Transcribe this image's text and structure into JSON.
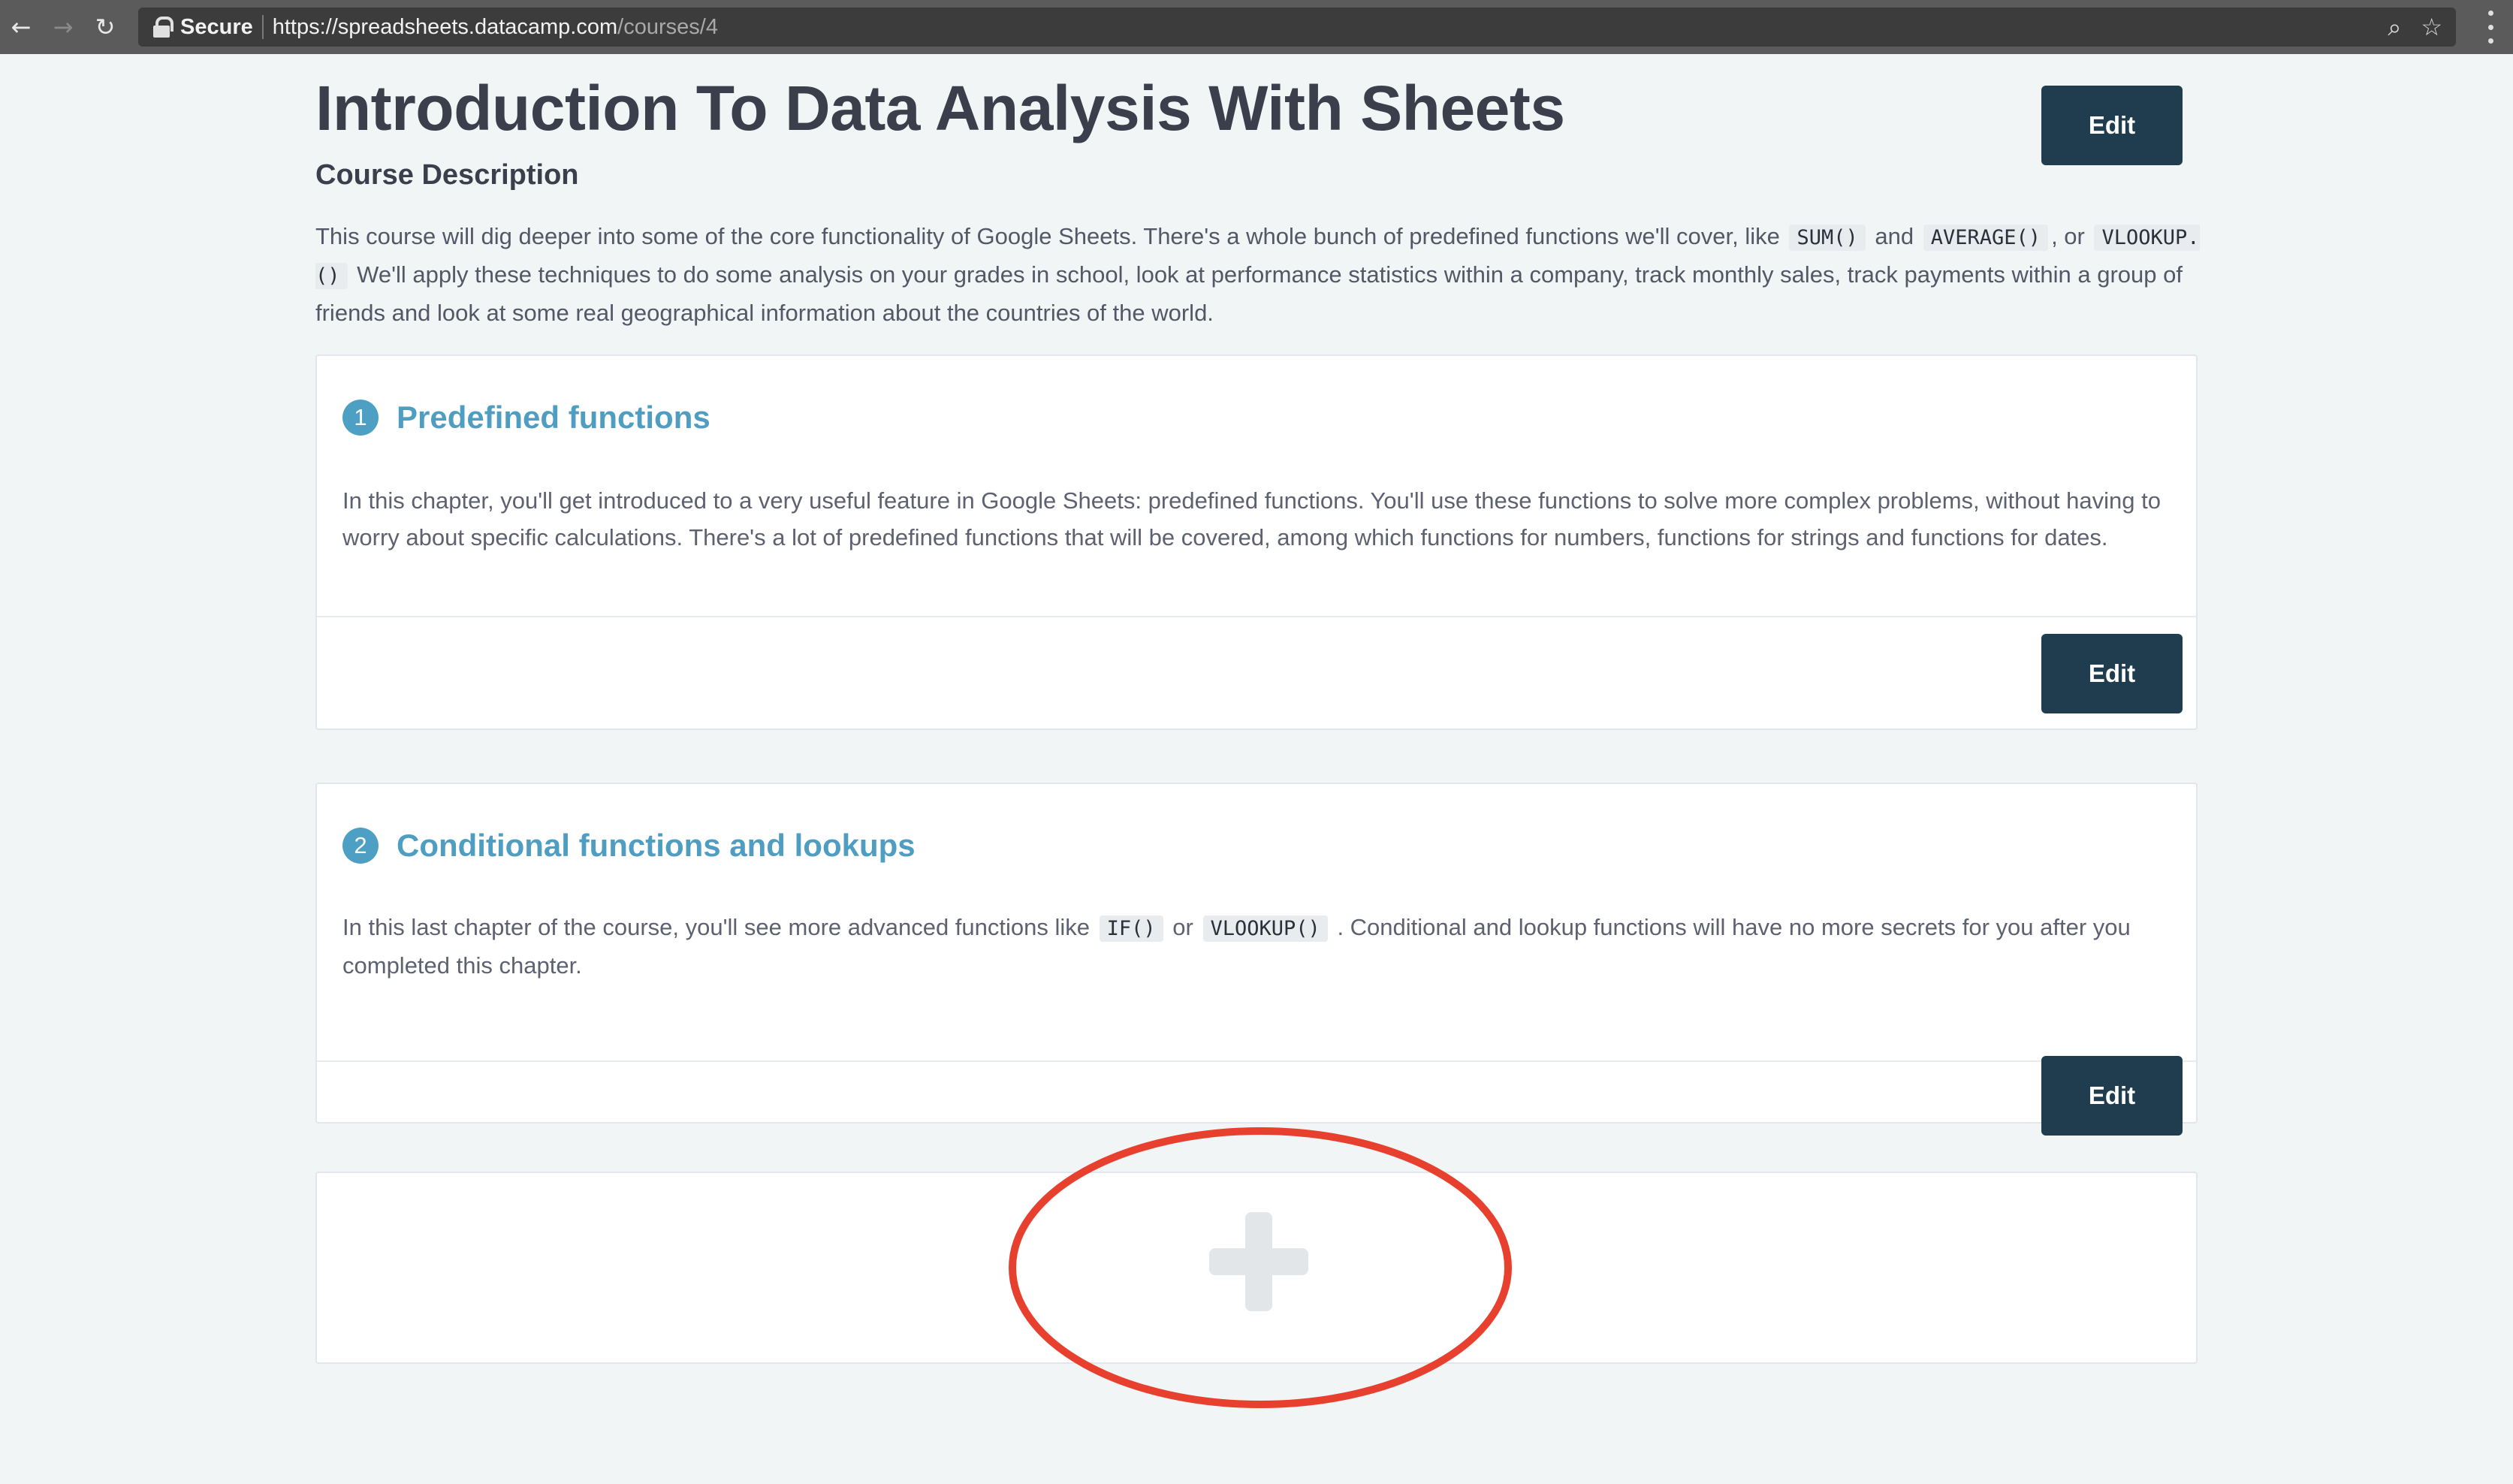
{
  "browser": {
    "secure_label": "Secure",
    "url_host": "https://spreadsheets.datacamp.com",
    "url_path": "/courses/4"
  },
  "course": {
    "title": "Introduction To Data Analysis With Sheets",
    "edit_label": "Edit",
    "description_heading": "Course Description",
    "description": {
      "part1": "This course will dig deeper into some of the core functionality of Google Sheets. There's a whole bunch of predefined functions we'll cover, like",
      "code1": "SUM()",
      "part2": "and",
      "code2": "AVERAGE()",
      "part3": ", or",
      "code3": "VLOOKUP.()",
      "part4": "We'll apply these techniques to do some analysis on your grades in school, look at performance statistics within a company, track monthly sales, track payments within a group of friends and look at some real geographical information about the countries of the world."
    }
  },
  "chapters": [
    {
      "number": "1",
      "title": "Predefined functions",
      "description": "In this chapter, you'll get introduced to a very useful feature in Google Sheets: predefined functions. You'll use these functions to solve more complex problems, without having to worry about specific calculations. There's a lot of predefined functions that will be covered, among which functions for numbers, functions for strings and functions for dates.",
      "edit_label": "Edit"
    },
    {
      "number": "2",
      "title": "Conditional functions and lookups",
      "desc_part1": "In this last chapter of the course, you'll see more advanced functions like",
      "desc_code1": "IF()",
      "desc_part2": "or",
      "desc_code2": "VLOOKUP()",
      "desc_part3": ". Conditional and lookup functions will have no more secrets for you after you completed this chapter.",
      "edit_label": "Edit"
    }
  ],
  "colors": {
    "accent": "#4f9ec2",
    "button": "#1f3d4f",
    "highlight": "#e8402e"
  }
}
